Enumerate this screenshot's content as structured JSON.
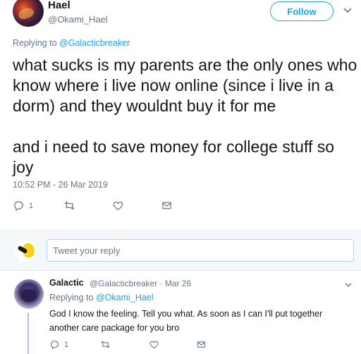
{
  "main_tweet": {
    "display_name": "Hael",
    "handle": "@Okami_Hael",
    "follow_label": "Follow",
    "replying_prefix": "Replying to ",
    "replying_to": "@Galacticbreaker",
    "text": "what sucks is my parents are the only ones who know where i live now online (since i live in a dorm) and they wouldnt buy it for me\n\nand i need to save money for college stuff so joy",
    "timestamp": "10:52 PM - 26 Mar 2019",
    "reply_count": "1",
    "icons": [
      "reply-icon",
      "retweet-icon",
      "like-icon",
      "message-icon"
    ]
  },
  "compose": {
    "placeholder": "Tweet your reply"
  },
  "reply_tweet": {
    "display_name": "Galactic",
    "meta": "@Galacticbreaker · Mar 26",
    "replying_prefix": "Replying to ",
    "replying_to": "@Okami_Hael",
    "text": "God I know the feeling. Tell you what. As soon as I can I'll put together another care package for you bro",
    "reply_count": "1"
  },
  "colors": {
    "accent": "#1da1f2",
    "secondary_text": "#657786",
    "thread_line": "#c9b3e8"
  }
}
